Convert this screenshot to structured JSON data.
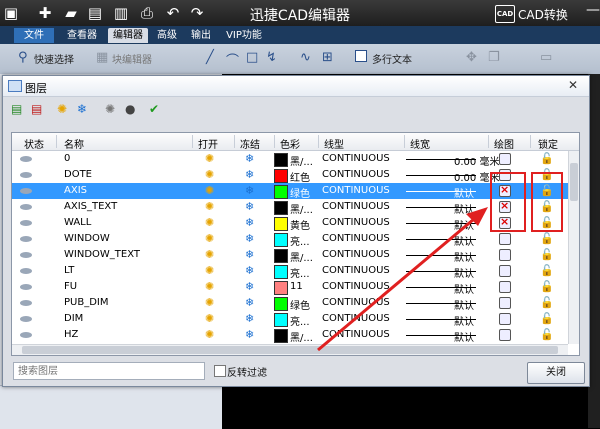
{
  "app": {
    "title": "迅捷CAD编辑器",
    "logo_text": "CAD",
    "convert_label": "CAD转换",
    "minimize_glyph": "—"
  },
  "menu": {
    "tabs": [
      {
        "label": "文件"
      },
      {
        "label": "查看器"
      },
      {
        "label": "编辑器"
      },
      {
        "label": "高级"
      },
      {
        "label": "输出"
      },
      {
        "label": "VIP功能"
      }
    ]
  },
  "toolbar": {
    "quick_select": "快速选择",
    "block_editor": "块编辑器",
    "multiline_text": "多行文本"
  },
  "dialog": {
    "title": "图层",
    "columns": [
      "状态",
      "名称",
      "打开",
      "冻结",
      "色彩",
      "线型",
      "线宽",
      "绘图",
      "锁定"
    ],
    "rows": [
      {
        "name": "0",
        "color_label": "黑/...",
        "color": "#000000",
        "linetype": "CONTINUOUS",
        "lineweight": "0.00 毫米",
        "print_off": false,
        "selected": false
      },
      {
        "name": "DOTE",
        "color_label": "红色",
        "color": "#ff0000",
        "linetype": "CONTINUOUS",
        "lineweight": "0.00 毫米",
        "print_off": false,
        "selected": false
      },
      {
        "name": "AXIS",
        "color_label": "绿色",
        "color": "#00ff00",
        "linetype": "CONTINUOUS",
        "lineweight": "默认",
        "print_off": true,
        "selected": true
      },
      {
        "name": "AXIS_TEXT",
        "color_label": "黑/...",
        "color": "#000000",
        "linetype": "CONTINUOUS",
        "lineweight": "默认",
        "print_off": true,
        "selected": false
      },
      {
        "name": "WALL",
        "color_label": "黄色",
        "color": "#ffff00",
        "linetype": "CONTINUOUS",
        "lineweight": "默认",
        "print_off": true,
        "selected": false
      },
      {
        "name": "WINDOW",
        "color_label": "亮...",
        "color": "#00ffff",
        "linetype": "CONTINUOUS",
        "lineweight": "默认",
        "print_off": false,
        "selected": false
      },
      {
        "name": "WINDOW_TEXT",
        "color_label": "黑/...",
        "color": "#000000",
        "linetype": "CONTINUOUS",
        "lineweight": "默认",
        "print_off": false,
        "selected": false
      },
      {
        "name": "LT",
        "color_label": "亮...",
        "color": "#00ffff",
        "linetype": "CONTINUOUS",
        "lineweight": "默认",
        "print_off": false,
        "selected": false
      },
      {
        "name": "FU",
        "color_label": "11",
        "color": "#ff8080",
        "linetype": "CONTINUOUS",
        "lineweight": "默认",
        "print_off": false,
        "selected": false
      },
      {
        "name": "PUB_DIM",
        "color_label": "绿色",
        "color": "#00ff00",
        "linetype": "CONTINUOUS",
        "lineweight": "默认",
        "print_off": false,
        "selected": false
      },
      {
        "name": "DIM",
        "color_label": "亮...",
        "color": "#00ffff",
        "linetype": "CONTINUOUS",
        "lineweight": "默认",
        "print_off": false,
        "selected": false
      },
      {
        "name": "HZ",
        "color_label": "黑/...",
        "color": "#000000",
        "linetype": "CONTINUOUS",
        "lineweight": "默认",
        "print_off": false,
        "selected": false
      }
    ],
    "search_placeholder": "搜索图层",
    "reverse_filter_label": "反转过滤",
    "close_label": "关闭",
    "close_glyph": "✕"
  },
  "colors": {
    "annotation_red": "#e02020",
    "selection_blue": "#3399ff"
  }
}
